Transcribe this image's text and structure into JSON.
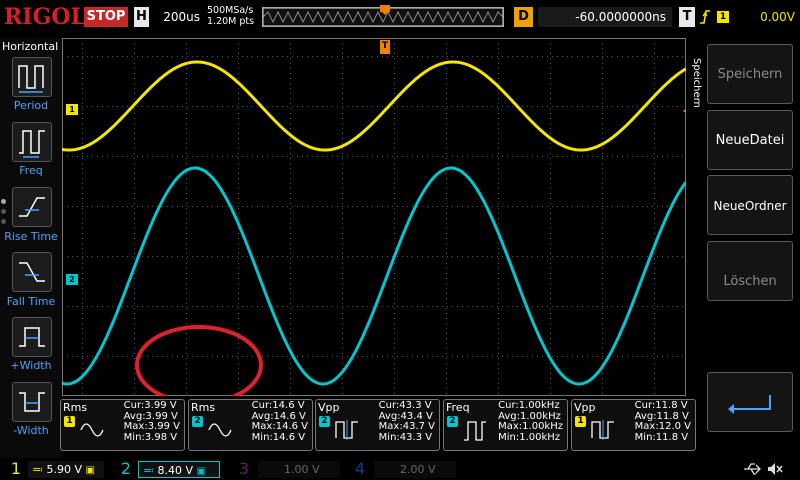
{
  "brand": "RIGOL",
  "status": "STOP",
  "horizontal": {
    "label": "H",
    "timebase": "200us",
    "sample_rate": "500MSa/s",
    "points": "1.20M pts"
  },
  "trigger": {
    "delay_label": "D",
    "delay": "-60.0000000ns",
    "type_label": "T",
    "source": "1",
    "level": "0.00V",
    "marker": "T"
  },
  "left_menu": {
    "title": "Horizontal",
    "items": [
      {
        "label": "Period"
      },
      {
        "label": "Freq"
      },
      {
        "label": "Rise Time"
      },
      {
        "label": "Fall Time"
      },
      {
        "label": "+Width"
      },
      {
        "label": "-Width"
      }
    ]
  },
  "right_menu": {
    "side_title": "Speichern",
    "items": [
      {
        "label": "Speichern"
      },
      {
        "label": "NeueDatei"
      },
      {
        "label": "NeueOrdner"
      },
      {
        "label": "Löschen"
      }
    ]
  },
  "channel_markers": {
    "ch1": "1",
    "ch2": "2"
  },
  "colors": {
    "ch1": "#f3e600",
    "ch2": "#00c8d0",
    "ch3": "#c020c0",
    "ch4": "#2060ff",
    "annotation": "#e0202a",
    "grid": "#5a5a5a"
  },
  "measurements": [
    {
      "title": "Rms",
      "ch": "1",
      "cur": "Cur:3.99 V",
      "avg": "Avg:3.99 V",
      "max": "Max:3.99 V",
      "min": "Min:3.98 V"
    },
    {
      "title": "Rms",
      "ch": "2",
      "cur": "Cur:14.6 V",
      "avg": "Avg:14.6 V",
      "max": "Max:14.6 V",
      "min": "Min:14.6 V"
    },
    {
      "title": "Vpp",
      "ch": "2",
      "cur": "Cur:43.3 V",
      "avg": "Avg:43.4 V",
      "max": "Max:43.7 V",
      "min": "Min:43.3 V"
    },
    {
      "title": "Freq",
      "ch": "2",
      "cur": "Cur:1.00kHz",
      "avg": "Avg:1.00kHz",
      "max": "Max:1.00kHz",
      "min": "Min:1.00kHz"
    },
    {
      "title": "Vpp",
      "ch": "1",
      "cur": "Cur:11.8 V",
      "avg": "Avg:11.8 V",
      "max": "Max:12.0 V",
      "min": "Min:11.8 V"
    }
  ],
  "channels": [
    {
      "num": "1",
      "scale": "5.90 V"
    },
    {
      "num": "2",
      "scale": "8.40 V"
    },
    {
      "num": "3",
      "scale": "1.00 V"
    },
    {
      "num": "4",
      "scale": "2.00 V"
    }
  ]
}
